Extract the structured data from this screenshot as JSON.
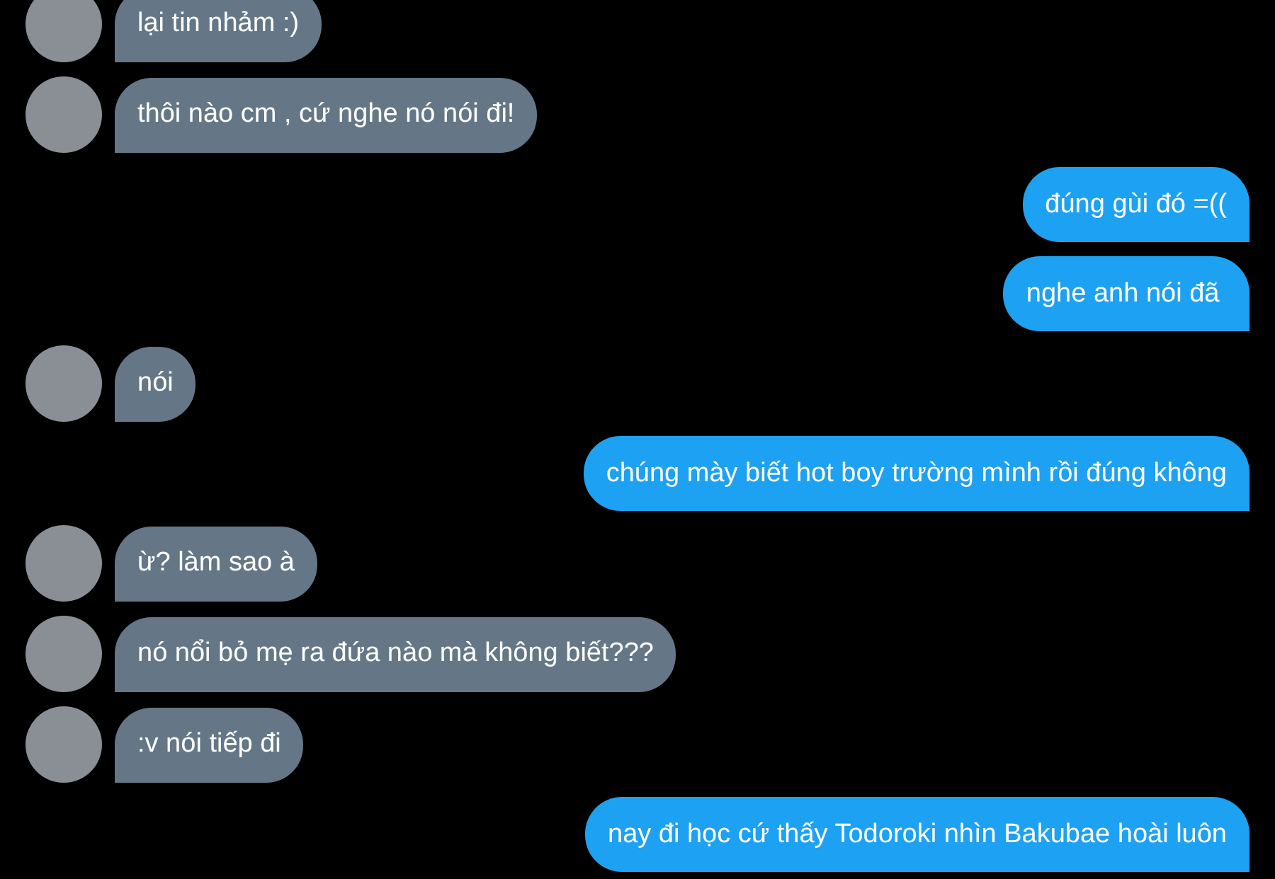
{
  "messages": [
    {
      "kind": "received",
      "text": "lại tin nhảm :)"
    },
    {
      "kind": "received",
      "text": "thôi nào cm , cứ nghe nó nói đi!"
    },
    {
      "kind": "sent",
      "text": "đúng gùi đó =(("
    },
    {
      "kind": "sent",
      "text": "nghe anh nói đã "
    },
    {
      "kind": "received",
      "text": "nói"
    },
    {
      "kind": "sent",
      "text": "chúng mày biết hot boy trường mình rồi đúng không"
    },
    {
      "kind": "received",
      "text": "ừ? làm sao à"
    },
    {
      "kind": "received",
      "text": "nó nổi bỏ mẹ ra đứa nào mà không biết???"
    },
    {
      "kind": "received",
      "text": ":v nói tiếp đi"
    },
    {
      "kind": "sent",
      "text": "nay đi học cứ thấy Todoroki nhìn Bakubae hoài luôn"
    }
  ]
}
